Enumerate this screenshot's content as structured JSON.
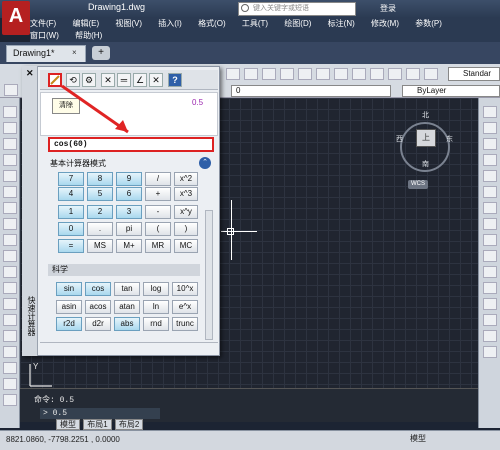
{
  "window": {
    "title": "Drawing1.dwg",
    "search_placeholder": "键入关键字或短语",
    "user": "登录"
  },
  "menu": {
    "row1": [
      "文件(F)",
      "编辑(E)",
      "视图(V)",
      "插入(I)",
      "格式(O)",
      "工具(T)",
      "绘图(D)",
      "标注(N)",
      "修改(M)",
      "参数(P)"
    ],
    "row2": [
      "窗口(W)",
      "帮助(H)"
    ]
  },
  "tabs": {
    "drawing": "Drawing1*",
    "close": "×",
    "new": "+"
  },
  "toolbar": {
    "layer_value": "0",
    "bylayer_value": "ByLayer",
    "style_value": "Standar"
  },
  "viewcube": {
    "north": "北",
    "south": "南",
    "west": "西",
    "east": "东",
    "face": "上",
    "wcs": "WCS"
  },
  "calculator": {
    "close": "✕",
    "vertical_title": "快速计算器",
    "tooltip": "清除",
    "history_value": "0.5",
    "input_value": "cos(60)",
    "basic_title": "基本计算器模式",
    "toggle": "⌃",
    "basic_keys": [
      [
        "7",
        "8",
        "9",
        "/",
        "x^2"
      ],
      [
        "4",
        "5",
        "6",
        "+",
        "x^3"
      ],
      [
        "1",
        "2",
        "3",
        "-",
        "x^y"
      ],
      [
        "0",
        ".",
        "pi",
        "(",
        ")"
      ],
      [
        "=",
        "MS",
        "M+",
        "MR",
        "MC"
      ]
    ],
    "sci_title": "科学",
    "sci_keys": [
      [
        "sin",
        "cos",
        "tan",
        "log",
        "10^x"
      ],
      [
        "asin",
        "acos",
        "atan",
        "ln",
        "e^x"
      ],
      [
        "r2d",
        "d2r",
        "abs",
        "rnd",
        "trunc"
      ]
    ]
  },
  "command": {
    "history": "命令: 0.5",
    "prompt": "> 0.5"
  },
  "layout_tabs": [
    "模型",
    "布局1",
    "布局2"
  ],
  "status": {
    "coords": "8821.0860, -7798.2251 , 0.0000",
    "model": "模型"
  },
  "colors": {
    "accent_red": "#d22222",
    "history_value": "#9c27b0",
    "key_blue": "#a9d8ee"
  }
}
